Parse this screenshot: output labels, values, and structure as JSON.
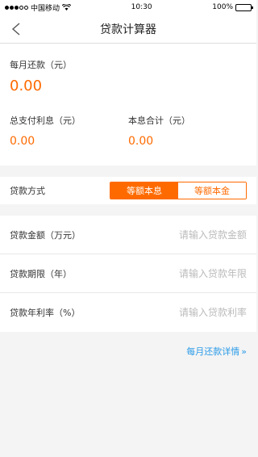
{
  "status_bar": {
    "carrier": "中国移动",
    "time": "10:30",
    "battery": "100%",
    "battery_level": 1.0
  },
  "nav": {
    "title": "贷款计算器"
  },
  "results": {
    "monthly_label": "每月还款（元）",
    "monthly_value": "0.00",
    "interest_label": "总支付利息（元）",
    "interest_value": "0.00",
    "total_label": "本息合计（元）",
    "total_value": "0.00"
  },
  "method": {
    "label": "贷款方式",
    "options": [
      "等额本息",
      "等额本金"
    ],
    "selected": "等额本息"
  },
  "inputs": [
    {
      "label": "贷款金额（万元）",
      "placeholder": "请输入贷款金额",
      "value": ""
    },
    {
      "label": "贷款期限（年）",
      "placeholder": "请输入贷款年限",
      "value": ""
    },
    {
      "label": "贷款年利率（%）",
      "placeholder": "请输入贷款利率",
      "value": ""
    }
  ],
  "detail_link": {
    "label": "每月还款详情",
    "icon": "double-chevron-right-icon"
  },
  "colors": {
    "accent": "#ff6a00",
    "link": "#2b9be8"
  }
}
